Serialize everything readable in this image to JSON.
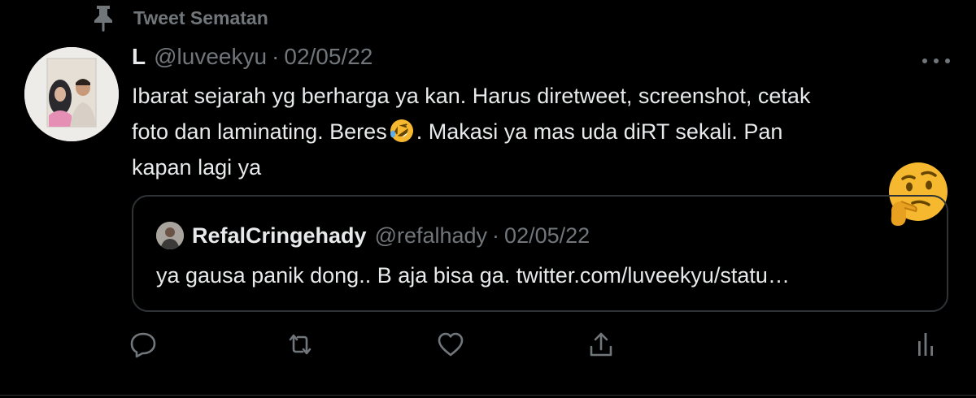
{
  "pinned": {
    "label": "Tweet Sematan",
    "icon": "pin-icon"
  },
  "tweet": {
    "author_name": "L",
    "author_handle": "@luveekyu",
    "separator": "·",
    "date": "02/05/22",
    "text_line1": "Ibarat sejarah yg berharga ya kan. Harus diretweet, screenshot, cetak",
    "text_line2_before_emoji": "foto dan laminating. Beres",
    "text_line2_after_emoji": ". Makasi ya mas uda diRT sekali. Pan",
    "text_line3": "kapan lagi ya",
    "inline_emoji": "rolling-on-floor-laughing",
    "overlay_emoji": "thinking-face"
  },
  "quoted_tweet": {
    "author_name": "RefalCringehady",
    "author_handle": "@refalhady",
    "separator": "·",
    "date": "02/05/22",
    "text": "ya gausa panik dong.. B aja bisa ga. twitter.com/luveekyu/statu…"
  },
  "actions": [
    {
      "name": "reply",
      "icon": "reply-icon"
    },
    {
      "name": "retweet",
      "icon": "retweet-icon"
    },
    {
      "name": "like",
      "icon": "heart-icon"
    },
    {
      "name": "share",
      "icon": "share-icon"
    },
    {
      "name": "analytics",
      "icon": "analytics-icon"
    }
  ],
  "colors": {
    "background": "#000000",
    "primary_text": "#e7e9ea",
    "secondary_text": "#71767b",
    "border": "#2f3336",
    "emoji_yellow": "#f5b82e"
  }
}
